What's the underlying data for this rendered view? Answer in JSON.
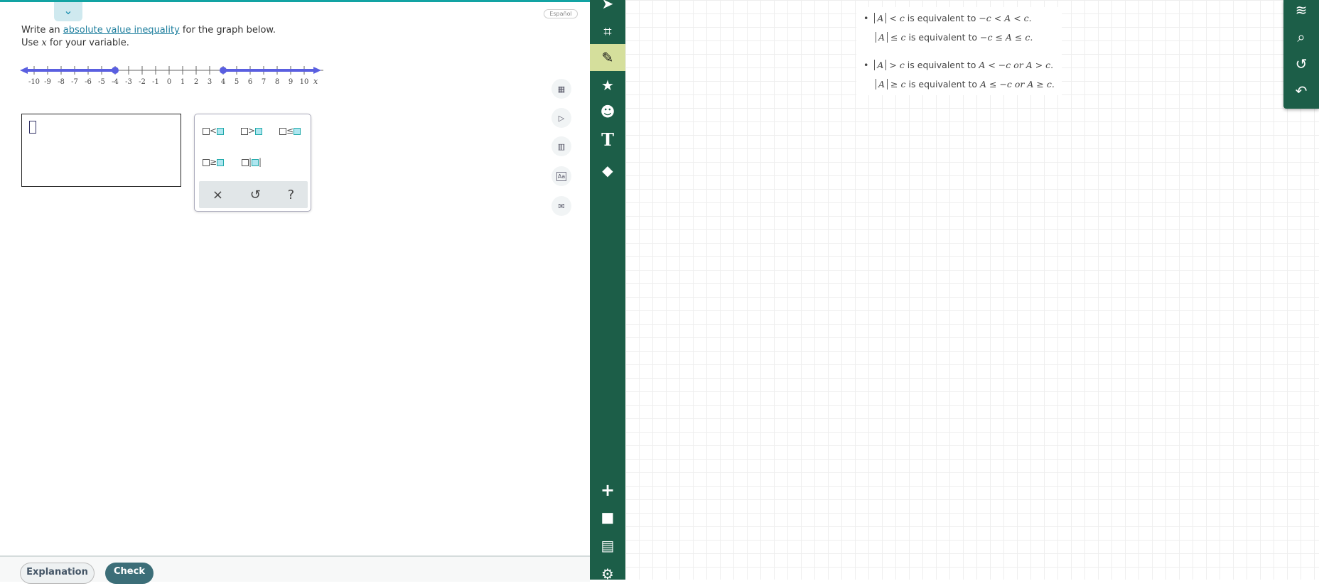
{
  "question": {
    "prefix": "Write an ",
    "link": "absolute value inequality",
    "suffix": " for the graph below.",
    "line2_pre": "Use ",
    "variable": "x",
    "line2_post": " for your variable."
  },
  "number_line": {
    "min": -10,
    "max": 10,
    "labels": [
      "-10",
      "-9",
      "-8",
      "-7",
      "-6",
      "-5",
      "-4",
      "-3",
      "-2",
      "-1",
      "0",
      "1",
      "2",
      "3",
      "4",
      "5",
      "6",
      "7",
      "8",
      "9",
      "10"
    ],
    "axis_label": "x",
    "closed_points": [
      -4,
      4
    ],
    "shaded": [
      [
        -10,
        -4
      ],
      [
        4,
        10
      ]
    ],
    "color": "#5a5fe0"
  },
  "keypad": {
    "keys": [
      "<",
      ">",
      "≤",
      "≥",
      "|□|"
    ],
    "clear": "×",
    "undo": "↺",
    "help": "?"
  },
  "language_label": "Español",
  "side_icons": [
    "calculator-icon",
    "video-icon",
    "textbook-icon",
    "glossary-icon",
    "message-icon"
  ],
  "glossary_label": "Aa",
  "footer": {
    "explanation": "Explanation",
    "check": "Check"
  },
  "rules": [
    {
      "lhs": "A",
      "op": "<",
      "rhs": "c",
      "mid": " is equivalent to ",
      "result": "−c < A < c."
    },
    {
      "lhs": "A",
      "op": "≤",
      "rhs": "c",
      "mid": " is equivalent to ",
      "result": "−c ≤ A ≤ c."
    },
    {
      "lhs": "A",
      "op": ">",
      "rhs": "c",
      "mid": " is equivalent to ",
      "result": "A < −c or A > c."
    },
    {
      "lhs": "A",
      "op": "≥",
      "rhs": "c",
      "mid": " is equivalent to ",
      "result": "A ≤ −c or A ≥ c."
    }
  ],
  "colors": {
    "accent": "#12a3a3",
    "toolbar": "#1c5e48",
    "active_tool": "#d5df9c",
    "check": "#3c6e78"
  }
}
